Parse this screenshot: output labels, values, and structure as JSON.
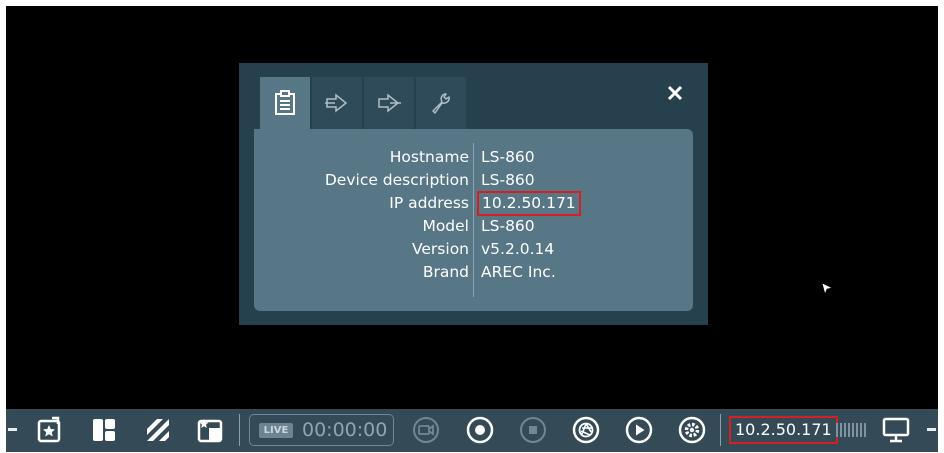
{
  "dialog": {
    "tabs": [
      {
        "name": "info-tab",
        "icon": "clipboard-icon",
        "active": true
      },
      {
        "name": "input-tab",
        "icon": "arrow-in-icon",
        "active": false
      },
      {
        "name": "output-tab",
        "icon": "arrow-out-icon",
        "active": false
      },
      {
        "name": "tools-tab",
        "icon": "wrench-icon",
        "active": false
      }
    ],
    "close_icon": "close-icon",
    "rows": [
      {
        "label": "Hostname",
        "value": "LS-860"
      },
      {
        "label": "Device description",
        "value": "LS-860"
      },
      {
        "label": "IP address",
        "value": "10.2.50.171",
        "highlighted": true
      },
      {
        "label": "Model",
        "value": "LS-860"
      },
      {
        "label": "Version",
        "value": "v5.2.0.14"
      },
      {
        "label": "Brand",
        "value": "AREC Inc."
      }
    ]
  },
  "taskbar": {
    "live_label": "LIVE",
    "timer": "00:00:00",
    "ip_address": "10.2.50.171",
    "left_edge_icon": "minus-icon",
    "right_edge_icon": "minus-icon",
    "icons": [
      "favorite-layout-icon",
      "layout-icon",
      "background-icon",
      "theme-icon",
      "camera-icon",
      "record-icon",
      "stop-icon",
      "snapshot-icon",
      "play-icon",
      "settings-icon",
      "signal-bars-icon",
      "monitor-icon"
    ]
  },
  "colors": {
    "background": "#000000",
    "dialog_frame": "#27404e",
    "dialog_panel": "#577686",
    "taskbar": "#344a56",
    "highlight": "#d42020"
  }
}
